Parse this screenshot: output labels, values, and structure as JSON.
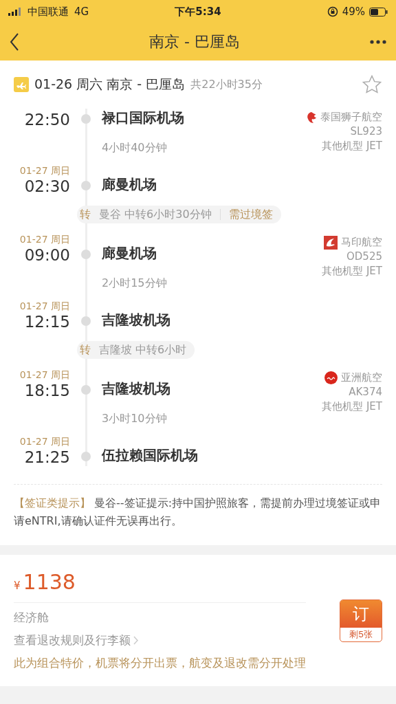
{
  "status_bar": {
    "carrier": "中国联通",
    "network": "4G",
    "time": "下午5:34",
    "battery": "49%"
  },
  "nav": {
    "title": "南京 - 巴厘岛"
  },
  "summary": {
    "route": "01-26 周六 南京 - 巴厘岛",
    "total": "共22小时35分",
    "favorite": false
  },
  "timeline": [
    {
      "kind": "flight",
      "depart": {
        "time": "22:50",
        "airport": "禄口国际机场"
      },
      "duration": "4小时40分钟",
      "arrive": {
        "date": "01-27 周日",
        "time": "02:30",
        "airport": "廊曼机场"
      },
      "airline": {
        "kind": "lion",
        "name": "泰国狮子航空",
        "code": "SL923",
        "aircraft": "其他机型 JET"
      }
    },
    {
      "kind": "transfer",
      "mark": "转",
      "text": "曼谷 中转6小时30分钟",
      "visa": "需过境签"
    },
    {
      "kind": "flight",
      "depart": {
        "date": "01-27 周日",
        "time": "09:00",
        "airport": "廊曼机场"
      },
      "duration": "2小时15分钟",
      "arrive": {
        "date": "01-27 周日",
        "time": "12:15",
        "airport": "吉隆坡机场"
      },
      "airline": {
        "kind": "square",
        "name": "马印航空",
        "code": "OD525",
        "aircraft": "其他机型 JET"
      }
    },
    {
      "kind": "transfer",
      "mark": "转",
      "text": "吉隆坡 中转6小时"
    },
    {
      "kind": "flight",
      "depart": {
        "date": "01-27 周日",
        "time": "18:15",
        "airport": "吉隆坡机场"
      },
      "duration": "3小时10分钟",
      "arrive": {
        "date": "01-27 周日",
        "time": "21:25",
        "airport": "伍拉赖国际机场"
      },
      "airline": {
        "kind": "circle",
        "name": "亚洲航空",
        "code": "AK374",
        "aircraft": "其他机型 JET"
      }
    }
  ],
  "visa_note": {
    "label": "【签证类提示】",
    "text": " 曼谷--签证提示:持中国护照旅客，需提前办理过境签证或申请eNTRI,请确认证件无误再出行。"
  },
  "price": {
    "currency": "¥",
    "amount": "1138",
    "cabin": "经济舱",
    "rules_link": "查看退改规则及行李额",
    "notice": "此为组合特价，机票将分开出票，航变及退改需分开处理",
    "book": "订",
    "remaining": "剩5张"
  }
}
